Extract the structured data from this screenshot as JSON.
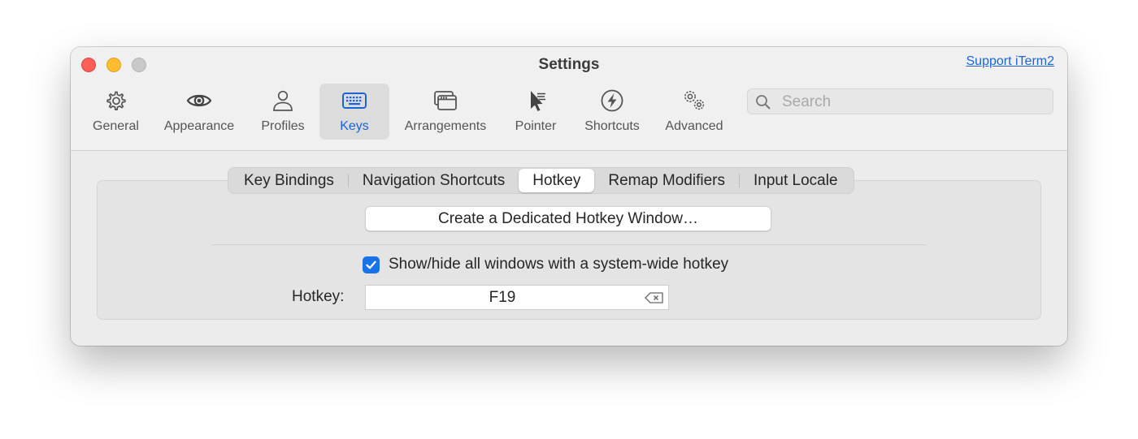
{
  "window": {
    "title": "Settings",
    "support_link": "Support iTerm2"
  },
  "toolbar": {
    "items": [
      {
        "label": "General",
        "icon": "gear-icon"
      },
      {
        "label": "Appearance",
        "icon": "eye-icon"
      },
      {
        "label": "Profiles",
        "icon": "person-icon"
      },
      {
        "label": "Keys",
        "icon": "keyboard-icon",
        "selected": true
      },
      {
        "label": "Arrangements",
        "icon": "windows-icon"
      },
      {
        "label": "Pointer",
        "icon": "pointer-icon"
      },
      {
        "label": "Shortcuts",
        "icon": "bolt-icon"
      },
      {
        "label": "Advanced",
        "icon": "gears-icon"
      }
    ]
  },
  "search": {
    "placeholder": "Search",
    "value": ""
  },
  "tabs": {
    "items": [
      "Key Bindings",
      "Navigation Shortcuts",
      "Hotkey",
      "Remap Modifiers",
      "Input Locale"
    ],
    "selected": "Hotkey"
  },
  "hotkey_pane": {
    "dedicated_button": "Create a Dedicated Hotkey Window…",
    "show_hide_checkbox": {
      "label": "Show/hide all windows with a system-wide hotkey",
      "checked": true
    },
    "hotkey_label": "Hotkey:",
    "hotkey_value": "F19"
  },
  "colors": {
    "accent": "#1a64d6",
    "checkbox": "#1a72e8",
    "close": "#ff5f57",
    "minimize": "#febc2e",
    "zoom": "#c9c9c9"
  }
}
